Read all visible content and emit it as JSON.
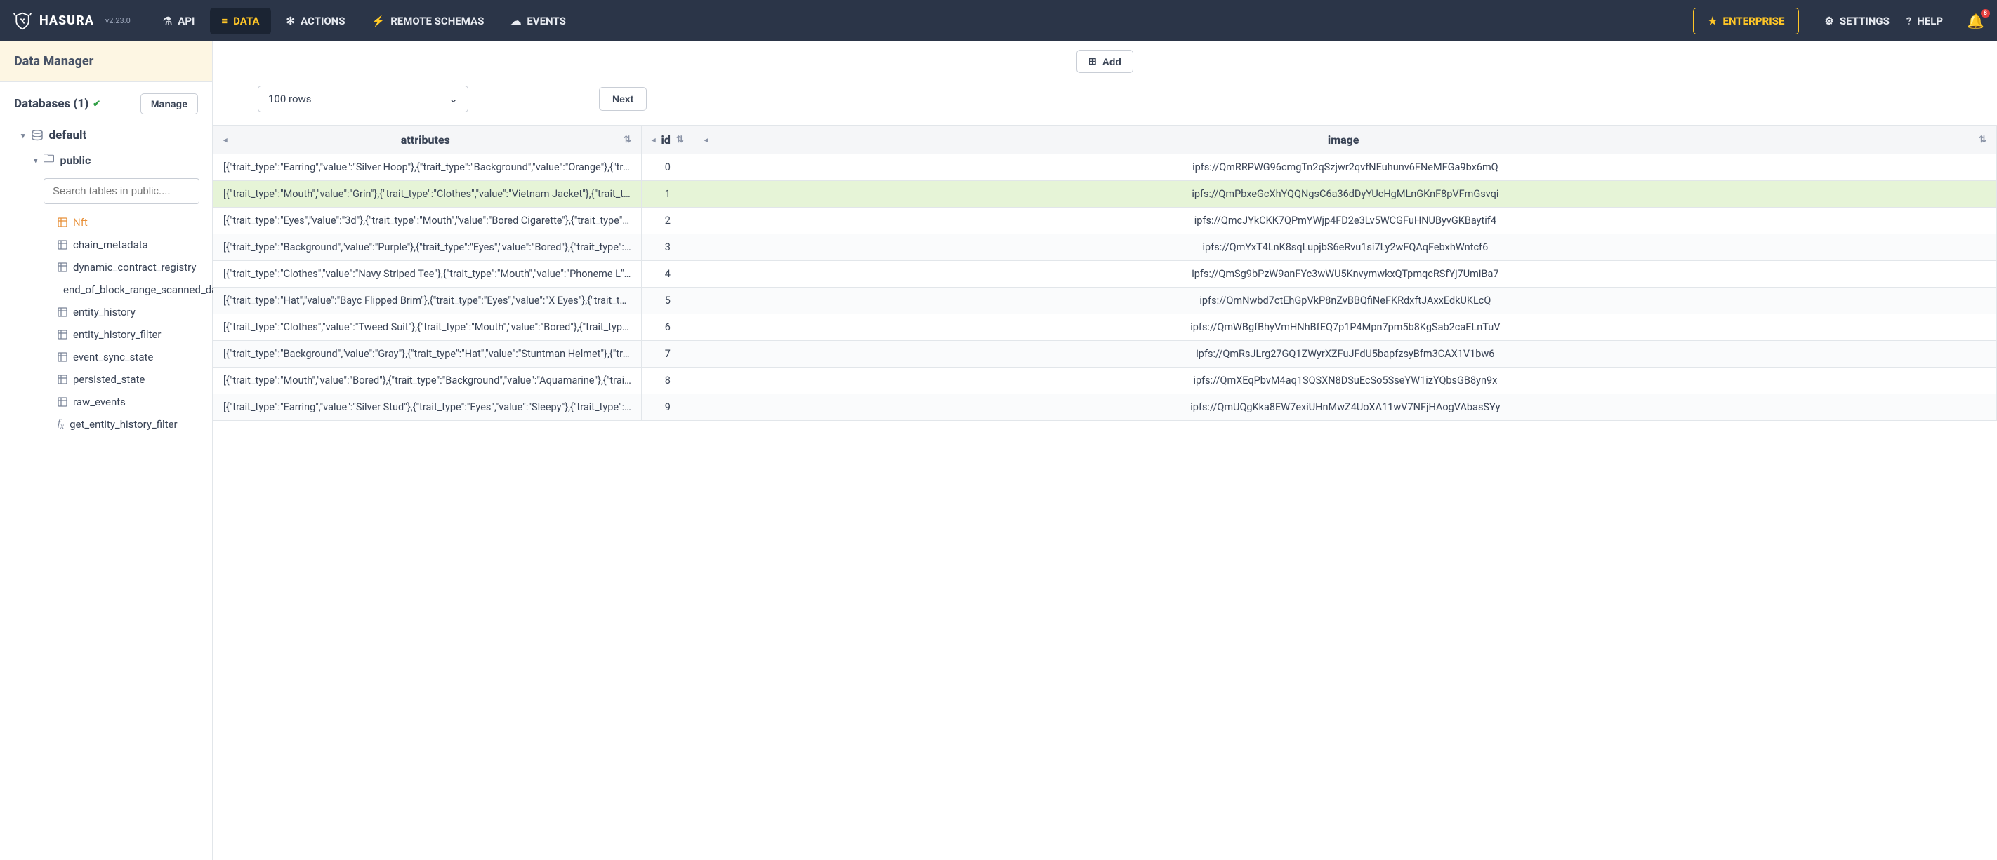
{
  "brand": {
    "name": "HASURA",
    "version": "v2.23.0"
  },
  "nav": {
    "api": "API",
    "data": "DATA",
    "actions": "ACTIONS",
    "remote_schemas": "REMOTE SCHEMAS",
    "events": "EVENTS",
    "enterprise": "ENTERPRISE",
    "settings": "SETTINGS",
    "help": "HELP",
    "bell_badge": "8"
  },
  "sidebar": {
    "data_manager": "Data Manager",
    "databases_label": "Databases (1)",
    "manage": "Manage",
    "db_name": "default",
    "schema_name": "public",
    "search_placeholder": "Search tables in public....",
    "tables": [
      "Nft",
      "chain_metadata",
      "dynamic_contract_registry",
      "end_of_block_range_scanned_data",
      "entity_history",
      "entity_history_filter",
      "event_sync_state",
      "persisted_state",
      "raw_events"
    ],
    "functions": [
      "get_entity_history_filter"
    ]
  },
  "toolbar": {
    "add": "Add",
    "rows_select": "100 rows",
    "next": "Next"
  },
  "columns": {
    "attributes": "attributes",
    "id": "id",
    "image": "image"
  },
  "rows": [
    {
      "id": "0",
      "attributes": "[{\"trait_type\":\"Earring\",\"value\":\"Silver Hoop\"},{\"trait_type\":\"Background\",\"value\":\"Orange\"},{\"trai...",
      "image": "ipfs://QmRRPWG96cmgTn2qSzjwr2qvfNEuhunv6FNeMFGa9bx6mQ"
    },
    {
      "id": "1",
      "attributes": "[{\"trait_type\":\"Mouth\",\"value\":\"Grin\"},{\"trait_type\":\"Clothes\",\"value\":\"Vietnam Jacket\"},{\"trait_typ...",
      "image": "ipfs://QmPbxeGcXhYQQNgsC6a36dDyYUcHgMLnGKnF8pVFmGsvqi",
      "highlight": true
    },
    {
      "id": "2",
      "attributes": "[{\"trait_type\":\"Eyes\",\"value\":\"3d\"},{\"trait_type\":\"Mouth\",\"value\":\"Bored Cigarette\"},{\"trait_type\":\"...",
      "image": "ipfs://QmcJYkCKK7QPmYWjp4FD2e3Lv5WCGFuHNUByvGKBaytif4"
    },
    {
      "id": "3",
      "attributes": "[{\"trait_type\":\"Background\",\"value\":\"Purple\"},{\"trait_type\":\"Eyes\",\"value\":\"Bored\"},{\"trait_type\":\"...",
      "image": "ipfs://QmYxT4LnK8sqLupjbS6eRvu1si7Ly2wFQAqFebxhWntcf6"
    },
    {
      "id": "4",
      "attributes": "[{\"trait_type\":\"Clothes\",\"value\":\"Navy Striped Tee\"},{\"trait_type\":\"Mouth\",\"value\":\"Phoneme L\"},{\"...",
      "image": "ipfs://QmSg9bPzW9anFYc3wWU5KnvymwkxQTpmqcRSfYj7UmiBa7"
    },
    {
      "id": "5",
      "attributes": "[{\"trait_type\":\"Hat\",\"value\":\"Bayc Flipped Brim\"},{\"trait_type\":\"Eyes\",\"value\":\"X Eyes\"},{\"trait_type...",
      "image": "ipfs://QmNwbd7ctEhGpVkP8nZvBBQfiNeFKRdxftJAxxEdkUKLcQ"
    },
    {
      "id": "6",
      "attributes": "[{\"trait_type\":\"Clothes\",\"value\":\"Tweed Suit\"},{\"trait_type\":\"Mouth\",\"value\":\"Bored\"},{\"trait_type\":...",
      "image": "ipfs://QmWBgfBhyVmHNhBfEQ7p1P4Mpn7pm5b8KgSab2caELnTuV"
    },
    {
      "id": "7",
      "attributes": "[{\"trait_type\":\"Background\",\"value\":\"Gray\"},{\"trait_type\":\"Hat\",\"value\":\"Stuntman Helmet\"},{\"trai...",
      "image": "ipfs://QmRsJLrg27GQ1ZWyrXZFuJFdU5bapfzsyBfm3CAX1V1bw6"
    },
    {
      "id": "8",
      "attributes": "[{\"trait_type\":\"Mouth\",\"value\":\"Bored\"},{\"trait_type\":\"Background\",\"value\":\"Aquamarine\"},{\"trait_...",
      "image": "ipfs://QmXEqPbvM4aq1SQSXN8DSuEcSo5SseYW1izYQbsGB8yn9x"
    },
    {
      "id": "9",
      "attributes": "[{\"trait_type\":\"Earring\",\"value\":\"Silver Stud\"},{\"trait_type\":\"Eyes\",\"value\":\"Sleepy\"},{\"trait_type\":\"...",
      "image": "ipfs://QmUQgKka8EW7exiUHnMwZ4UoXA11wV7NFjHAogVAbasSYy"
    }
  ]
}
